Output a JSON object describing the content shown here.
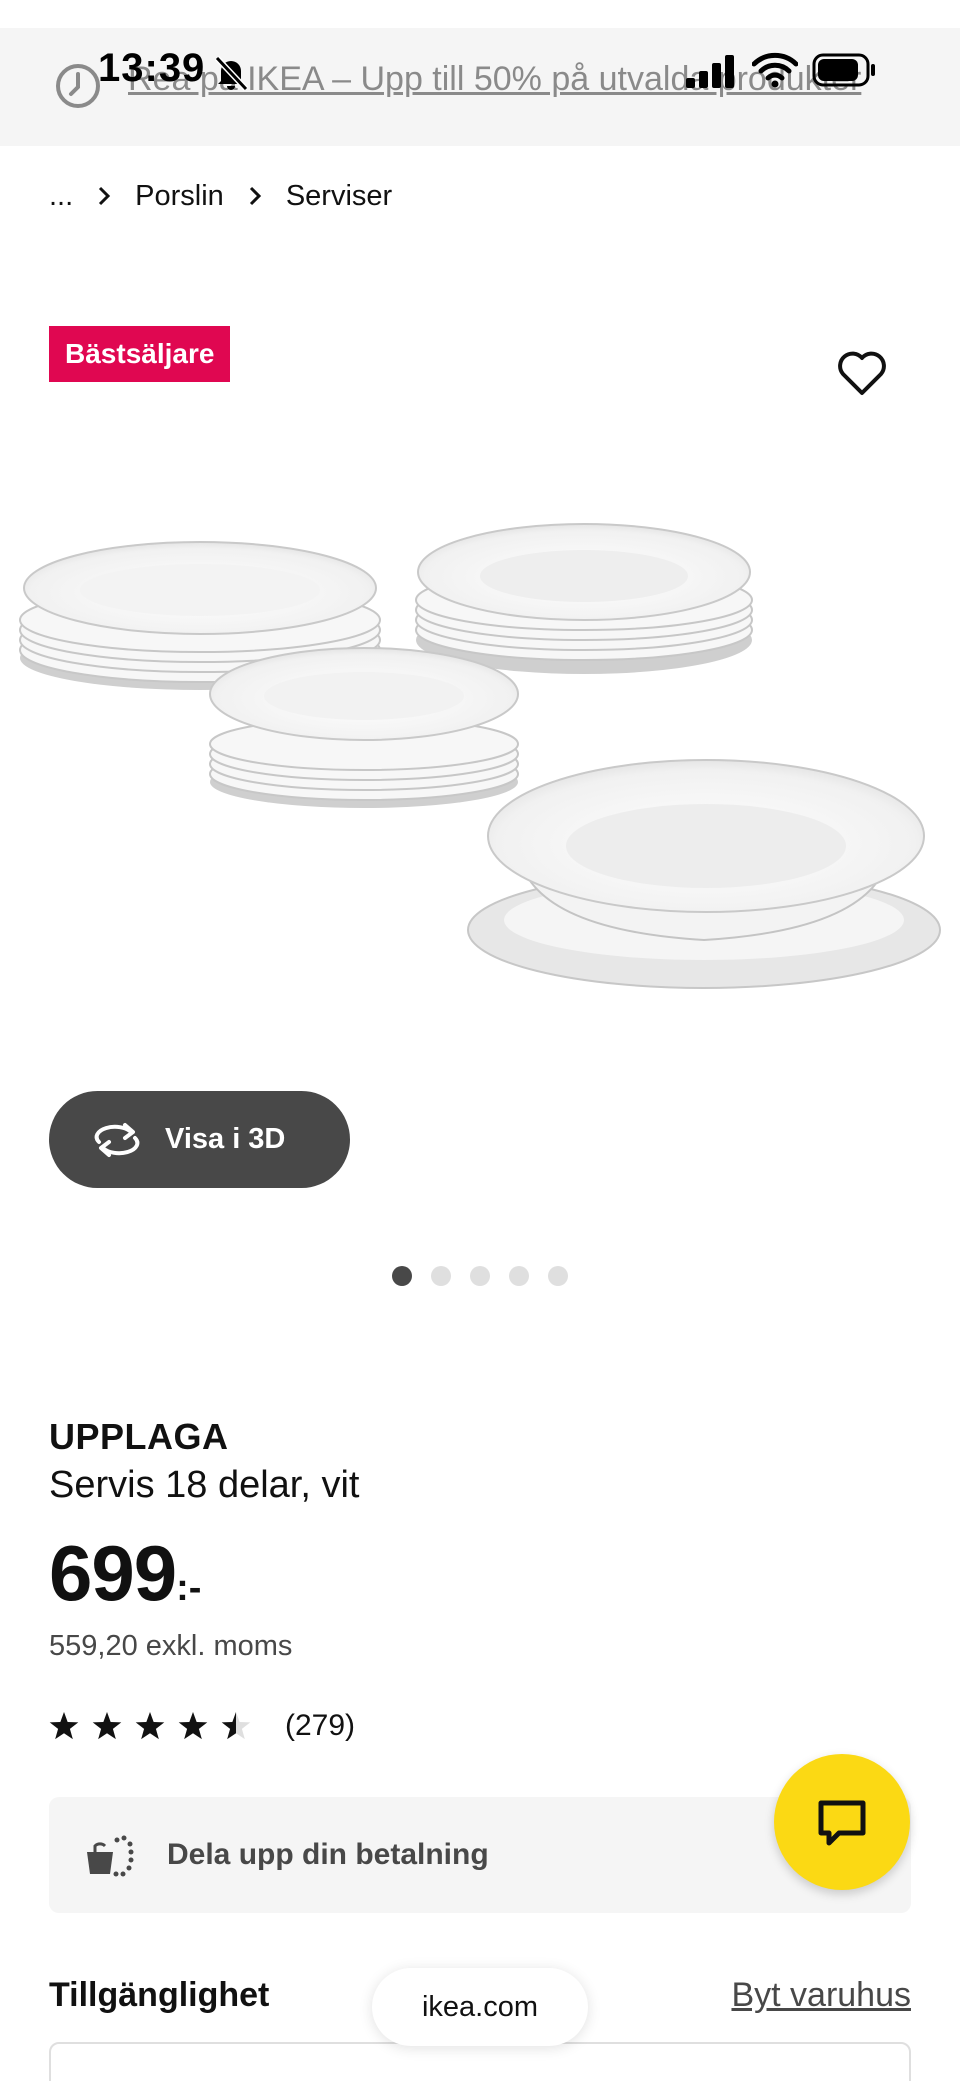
{
  "status_bar": {
    "time": "13:39"
  },
  "promo": {
    "text": "Rea på IKEA – Upp till 50% på utvalda produkter"
  },
  "breadcrumb": {
    "items": [
      "...",
      "Porslin",
      "Serviser"
    ]
  },
  "badge": {
    "label": "Bästsäljare"
  },
  "gallery": {
    "view_3d_label": "Visa i 3D",
    "slide_count": 5,
    "active_slide": 1
  },
  "product": {
    "name": "UPPLAGA",
    "description": "Servis 18 delar, vit",
    "price": "699",
    "price_suffix": ":-",
    "price_excl_vat": "559,20 exkl. moms",
    "rating": 4.5,
    "rating_max": 5,
    "review_count": "(279)"
  },
  "payment": {
    "label": "Dela upp din betalning"
  },
  "availability": {
    "title": "Tillgänglighet",
    "change_store": "Byt varuhus"
  },
  "browser": {
    "url": "ikea.com"
  },
  "colors": {
    "badge": "#e00751",
    "chat_button": "#fbd914",
    "dark_button": "#484848"
  },
  "icons": [
    "clock-icon",
    "bell-slash-icon",
    "cellular-signal-icon",
    "wifi-icon",
    "battery-icon",
    "chevron-right-icon",
    "heart-icon",
    "rotate-3d-icon",
    "payment-split-icon",
    "chat-icon",
    "star-icon"
  ]
}
